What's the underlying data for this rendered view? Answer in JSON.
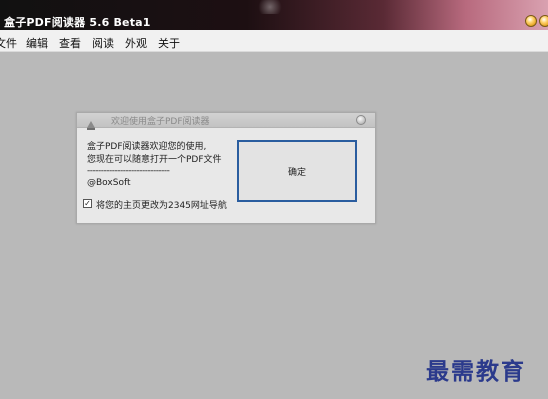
{
  "window": {
    "title": "盒子PDF阅读器 5.6 Beta1"
  },
  "menubar": {
    "items": [
      "文件",
      "编辑",
      "查看",
      "阅读",
      "外观",
      "关于"
    ]
  },
  "dialog": {
    "title": "欢迎使用盒子PDF阅读器",
    "lines": [
      "盒子PDF阅读器欢迎您的使用,",
      "您现在可以随意打开一个PDF文件",
      "------------------------------",
      "@BoxSoft"
    ],
    "ok_label": "确定",
    "checkbox": {
      "checked": true,
      "mark": "✓",
      "label": "将您的主页更改为2345网址导航"
    }
  },
  "watermark": "最需教育"
}
